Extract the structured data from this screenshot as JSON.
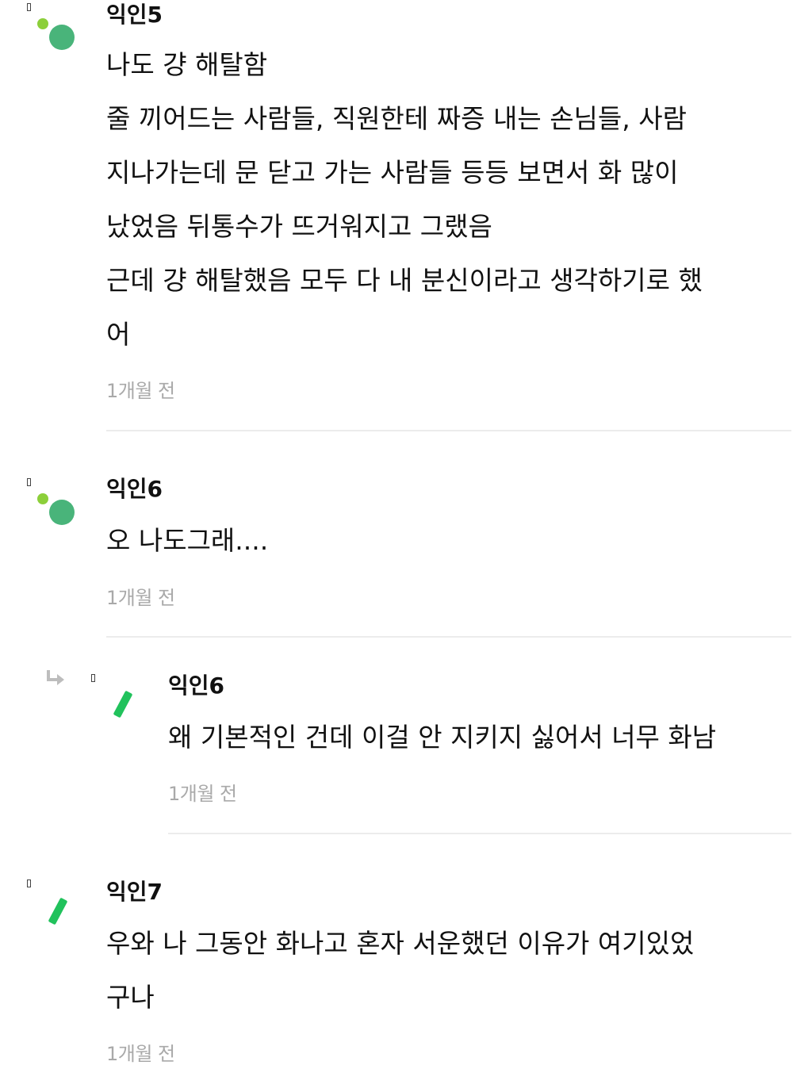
{
  "comments": [
    {
      "author": "익인5",
      "lines": [
        "나도 걍 해탈함",
        "줄 끼어드는 사람들, 직원한테 짜증 내는 손님들, 사람",
        "지나가는데 문 닫고 가는 사람들 등등 보면서 화 많이",
        "났었음 뒤통수가 뜨거워지고 그랬음",
        "근데 걍 해탈했음 모두 다 내 분신이라고 생각하기로 했",
        "어"
      ],
      "time": "1개월 전",
      "avatar_icon": "green-dots-icon"
    },
    {
      "author": "익인6",
      "lines": [
        "오 나도그래...."
      ],
      "time": "1개월 전",
      "avatar_icon": "green-dots-icon"
    },
    {
      "author": "익인6",
      "lines": [
        "왜 기본적인 건데 이걸 안 지키지 싫어서 너무 화남"
      ],
      "time": "1개월 전",
      "avatar_icon": "green-slash-icon",
      "reply_icon": "reply-arrow-icon"
    },
    {
      "author": "익인7",
      "lines": [
        "우와 나 그동안 화나고 혼자 서운했던 이유가 여기있었",
        "구나"
      ],
      "time": "1개월 전",
      "avatar_icon": "green-slash-icon"
    }
  ],
  "colors": {
    "author": "#111111",
    "body": "#111111",
    "timestamp": "#a9a9a9",
    "divider": "#ececec",
    "avatar_green_big": "#49b47a",
    "avatar_green_small": "#8ccf3a",
    "avatar_slash": "#21c25c"
  }
}
